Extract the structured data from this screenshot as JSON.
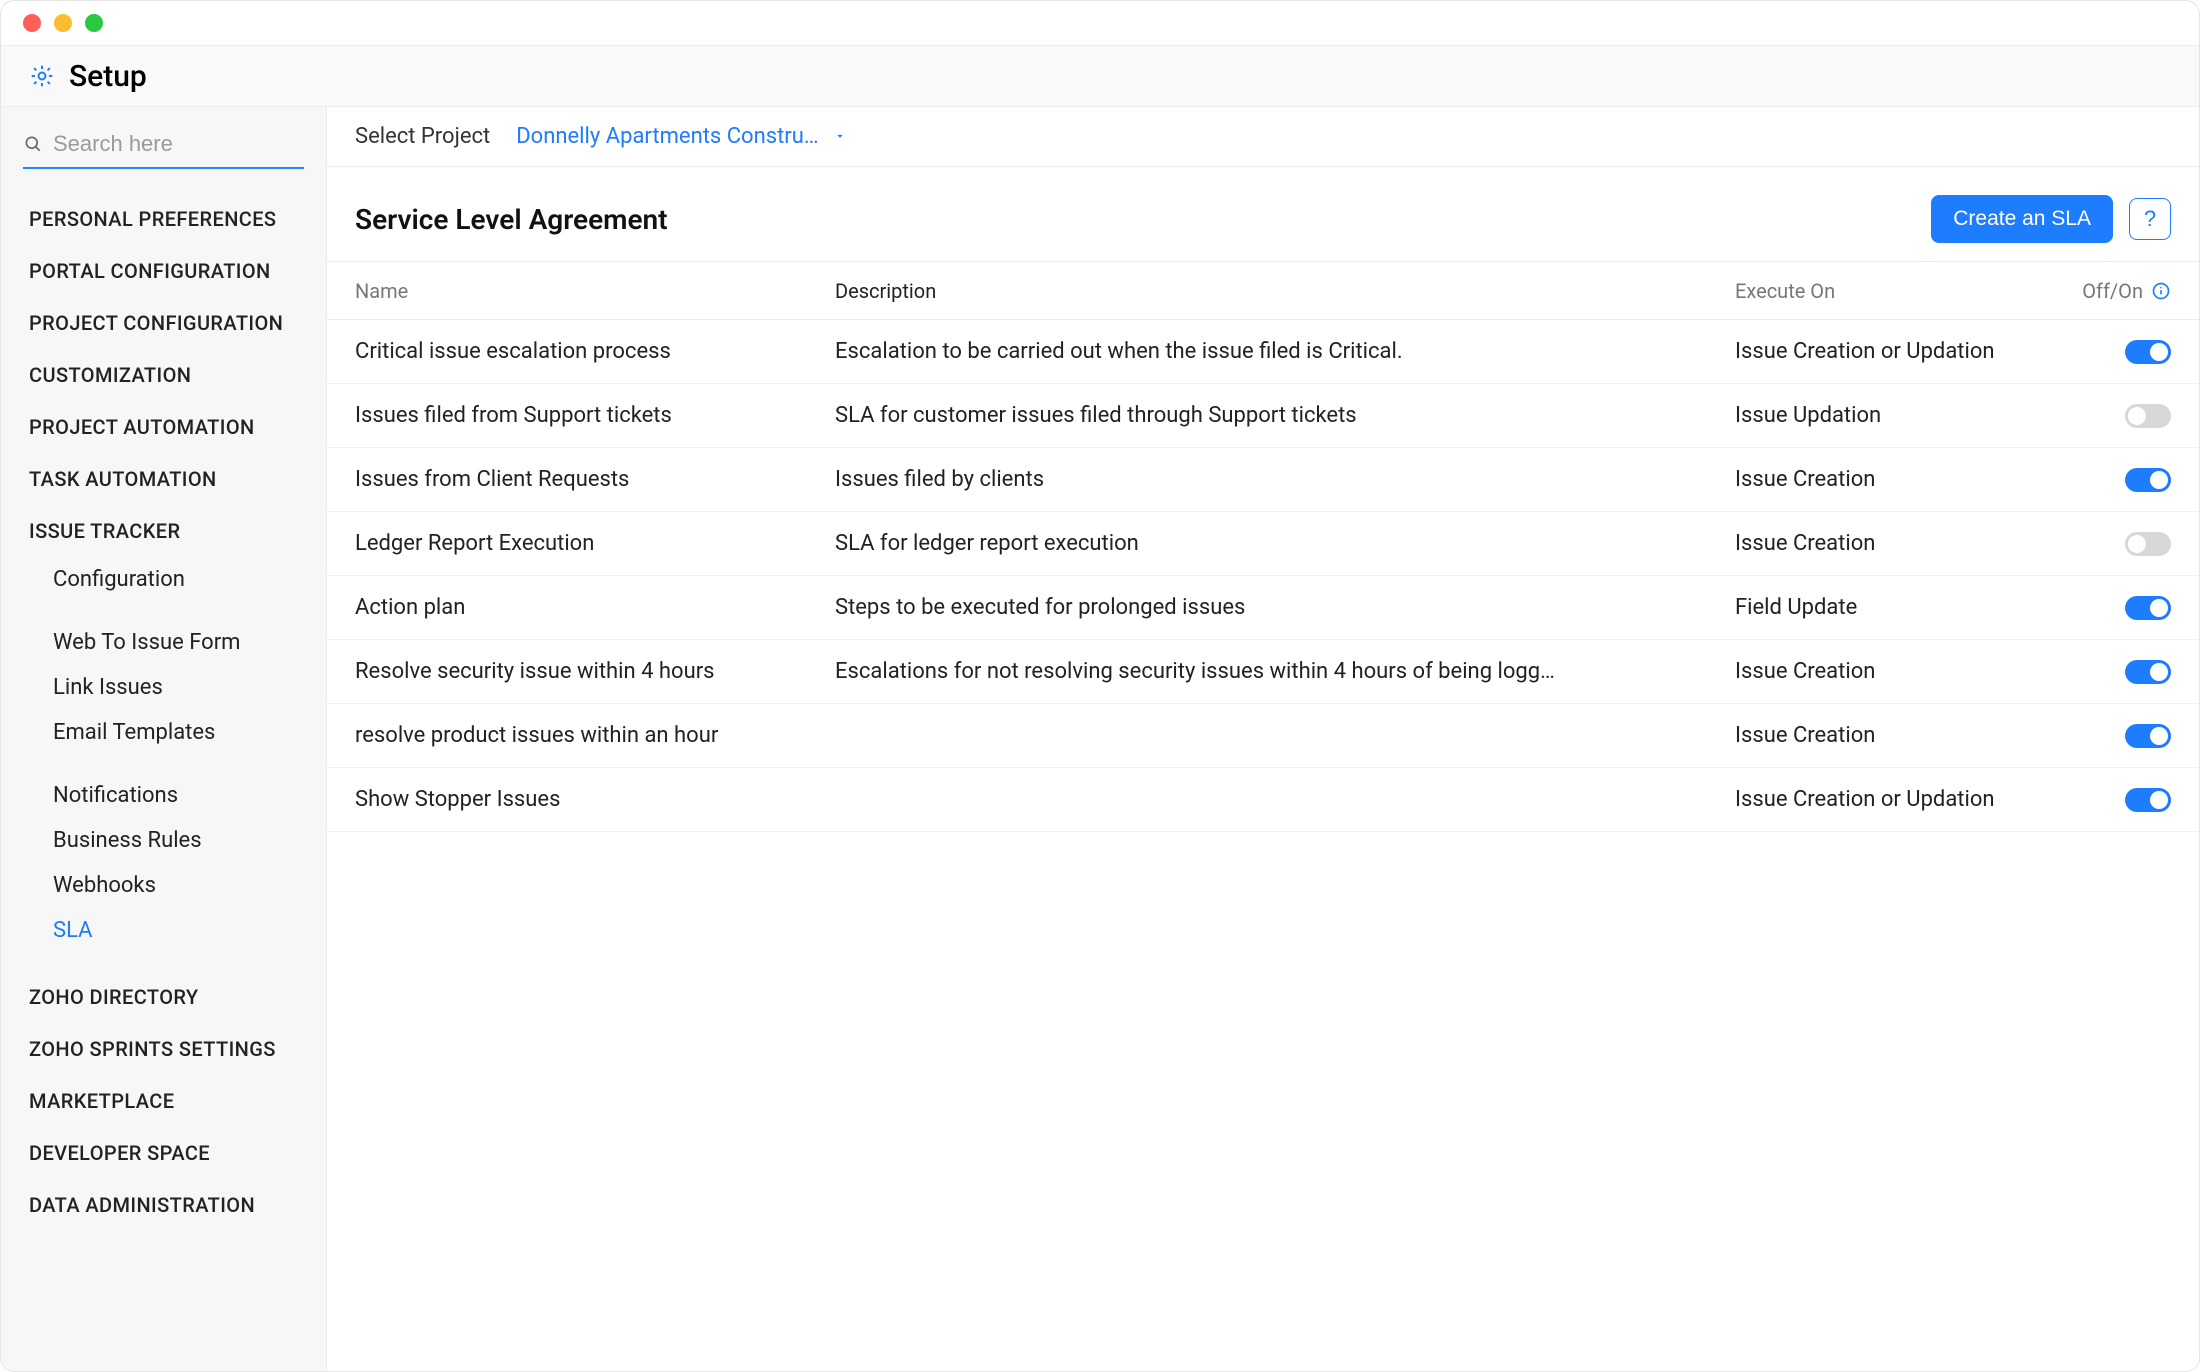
{
  "header": {
    "title": "Setup"
  },
  "sidebar": {
    "search_placeholder": "Search here",
    "items": [
      {
        "label": "PERSONAL PREFERENCES"
      },
      {
        "label": "PORTAL CONFIGURATION"
      },
      {
        "label": "PROJECT CONFIGURATION"
      },
      {
        "label": "CUSTOMIZATION"
      },
      {
        "label": "PROJECT AUTOMATION"
      },
      {
        "label": "TASK AUTOMATION"
      },
      {
        "label": "ISSUE TRACKER",
        "children": [
          {
            "label": "Configuration"
          },
          {
            "label": "Web To Issue Form"
          },
          {
            "label": "Link Issues"
          },
          {
            "label": "Email Templates"
          },
          {
            "label": "Notifications"
          },
          {
            "label": "Business Rules"
          },
          {
            "label": "Webhooks"
          },
          {
            "label": "SLA",
            "active": true
          }
        ]
      },
      {
        "label": "ZOHO DIRECTORY"
      },
      {
        "label": "ZOHO SPRINTS SETTINGS"
      },
      {
        "label": "MARKETPLACE"
      },
      {
        "label": "DEVELOPER SPACE"
      },
      {
        "label": "DATA ADMINISTRATION"
      }
    ]
  },
  "project_bar": {
    "label": "Select Project",
    "selected": "Donnelly Apartments Constru…"
  },
  "main": {
    "title": "Service Level Agreement",
    "create_button": "Create an SLA",
    "help_button": "?",
    "columns": {
      "name": "Name",
      "description": "Description",
      "execute_on": "Execute On",
      "off_on": "Off/On"
    },
    "rows": [
      {
        "name": "Critical issue escalation process",
        "description": "Escalation to be carried out when the issue filed is Critical.",
        "execute_on": "Issue Creation or Updation",
        "on": true
      },
      {
        "name": "Issues filed from Support tickets",
        "description": "SLA for customer issues filed through Support tickets",
        "execute_on": "Issue Updation",
        "on": false
      },
      {
        "name": "Issues from Client Requests",
        "description": "Issues filed by clients",
        "execute_on": "Issue Creation",
        "on": true
      },
      {
        "name": "Ledger Report Execution",
        "description": "SLA for ledger report execution",
        "execute_on": "Issue Creation",
        "on": false
      },
      {
        "name": "Action plan",
        "description": "Steps to be executed for prolonged issues",
        "execute_on": "Field Update",
        "on": true
      },
      {
        "name": "Resolve security issue within 4 hours",
        "description": "Escalations for not resolving security issues within 4 hours of being logg…",
        "execute_on": "Issue Creation",
        "on": true
      },
      {
        "name": "resolve product issues within an hour",
        "description": "",
        "execute_on": "Issue Creation",
        "on": true
      },
      {
        "name": "Show Stopper Issues",
        "description": "",
        "execute_on": "Issue Creation or Updation",
        "on": true
      }
    ]
  },
  "colors": {
    "accent": "#1e7cff",
    "border": "#ececec",
    "muted": "#9a9a9a"
  }
}
